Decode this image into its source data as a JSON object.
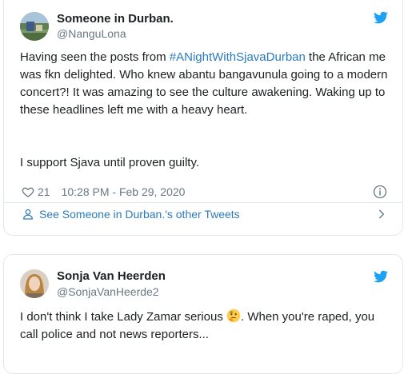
{
  "tweets": [
    {
      "author": {
        "name": "Someone in Durban.",
        "handle": "@NanguLona"
      },
      "text": {
        "intro": "Having seen the posts from ",
        "hashtag": "#ANightWithSjavaDurban",
        "body": " the African me was fkn delighted. Who knew abantu bangavunula going to a modern concert?! It was amazing to see the culture awakening. Waking up to these headlines left me with a heavy heart.",
        "closing": "I support Sjava until proven guilty."
      },
      "likes": "21",
      "timestamp": "10:28 PM - Feb 29, 2020",
      "more_tweets_label": "See Someone in Durban.'s other Tweets"
    },
    {
      "author": {
        "name": "Sonja Van Heerden",
        "handle": "@SonjaVanHeerde2"
      },
      "text": {
        "before_emoji": "I don't think I take Lady Zamar serious ",
        "after_emoji": ". When you're raped, you call police and not news reporters..."
      }
    }
  ],
  "icons": {
    "bird": "twitter-bird-icon",
    "heart": "heart-icon",
    "info": "info-icon",
    "person": "person-icon",
    "chevron": "chevron-right-icon",
    "emoji": "thinking-face-emoji"
  },
  "colors": {
    "link": "#2b7bb9",
    "twitter_blue": "#1da1f2",
    "muted": "#697882",
    "text": "#1c2022",
    "border": "#e1e8ed"
  }
}
